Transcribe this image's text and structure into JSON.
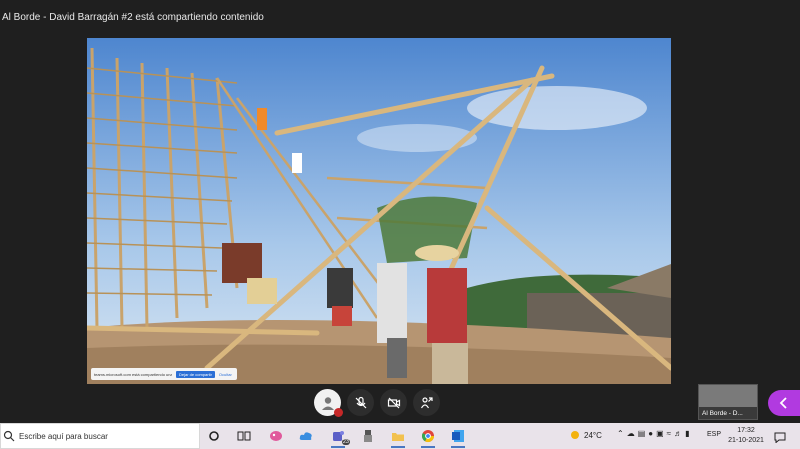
{
  "window": {
    "title": "Al Borde - David Barragán #2 está compartiendo contenido"
  },
  "share_bar": {
    "message": "teams.microsoft.com está compartiendo una ventana",
    "stop_label": "Dejar de compartir",
    "hide_label": "Ocultar"
  },
  "call_controls": {
    "items": [
      {
        "name": "user-avatar",
        "icon": "person-icon"
      },
      {
        "name": "mute-microphone",
        "icon": "mic-off-icon"
      },
      {
        "name": "camera-off",
        "icon": "camera-off-icon"
      },
      {
        "name": "share-screen",
        "icon": "share-icon"
      }
    ]
  },
  "participant": {
    "name": "Al Borde - D..."
  },
  "taskbar": {
    "search_placeholder": "Escribe aquí para buscar",
    "badge_count": "23",
    "weather": {
      "temp": "24°C"
    },
    "language": "ESP",
    "clock": {
      "time": "17:32",
      "date": "21-10-2021"
    }
  },
  "colors": {
    "accent": "#b13ae0",
    "taskbar_bg": "#e9e3ea",
    "stop_share": "#2b6fd6"
  }
}
